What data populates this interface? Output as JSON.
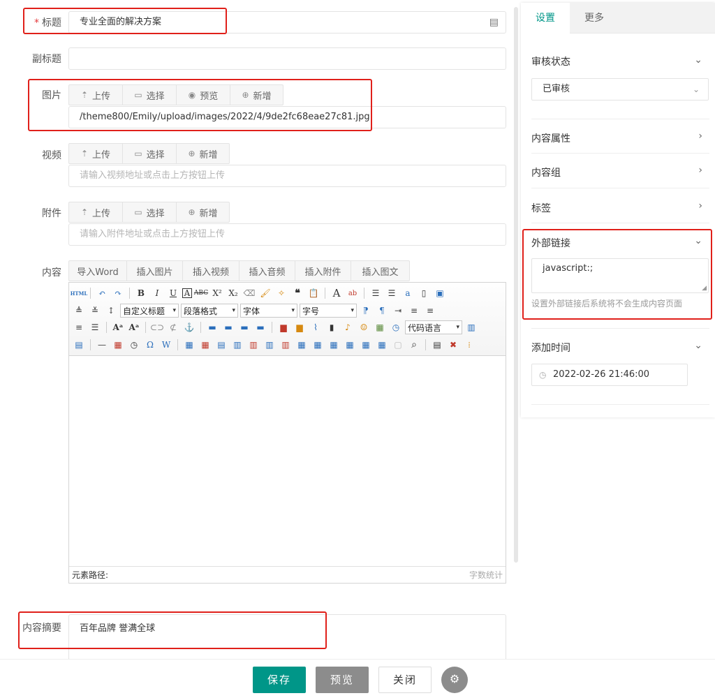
{
  "form": {
    "title_label": "标题",
    "title_required": "*",
    "title_value": "专业全面的解决方案",
    "subtitle_label": "副标题",
    "subtitle_value": "",
    "image_label": "图片",
    "image_value": "/theme800/Emily/upload/images/2022/4/9de2fc68eae27c81.jpg",
    "image_buttons": [
      "上传",
      "选择",
      "预览",
      "新增"
    ],
    "video_label": "视频",
    "video_placeholder": "请输入视频地址或点击上方按钮上传",
    "video_buttons": [
      "上传",
      "选择",
      "新增"
    ],
    "attach_label": "附件",
    "attach_placeholder": "请输入附件地址或点击上方按钮上传",
    "attach_buttons": [
      "上传",
      "选择",
      "新增"
    ],
    "content_label": "内容",
    "content_buttons": [
      "导入Word",
      "插入图片",
      "插入视频",
      "插入音频",
      "插入附件",
      "插入图文"
    ],
    "summary_label": "内容摘要",
    "summary_value": "百年品牌 誉满全球"
  },
  "editor": {
    "custom_heading": "自定义标题",
    "paragraph_format": "段落格式",
    "font_family": "字体",
    "font_size": "字号",
    "code_language": "代码语言",
    "element_path": "元素路径:",
    "word_count": "字数统计",
    "html_btn": "HTML"
  },
  "panel": {
    "tab_settings": "设置",
    "tab_more": "更多",
    "review_status_label": "审核状态",
    "review_status_value": "已审核",
    "content_attr_label": "内容属性",
    "content_group_label": "内容组",
    "tags_label": "标签",
    "external_link_label": "外部链接",
    "external_link_value": "javascript:;",
    "external_link_hint": "设置外部链接后系统将不会生成内容页面",
    "add_time_label": "添加时间",
    "add_time_value": "2022-02-26 21:46:00"
  },
  "actions": {
    "save": "保存",
    "preview": "预览",
    "close": "关闭"
  },
  "colors": {
    "accent": "#009688",
    "highlight_red": "#e0201a",
    "gray_button": "#8c8c8c"
  }
}
